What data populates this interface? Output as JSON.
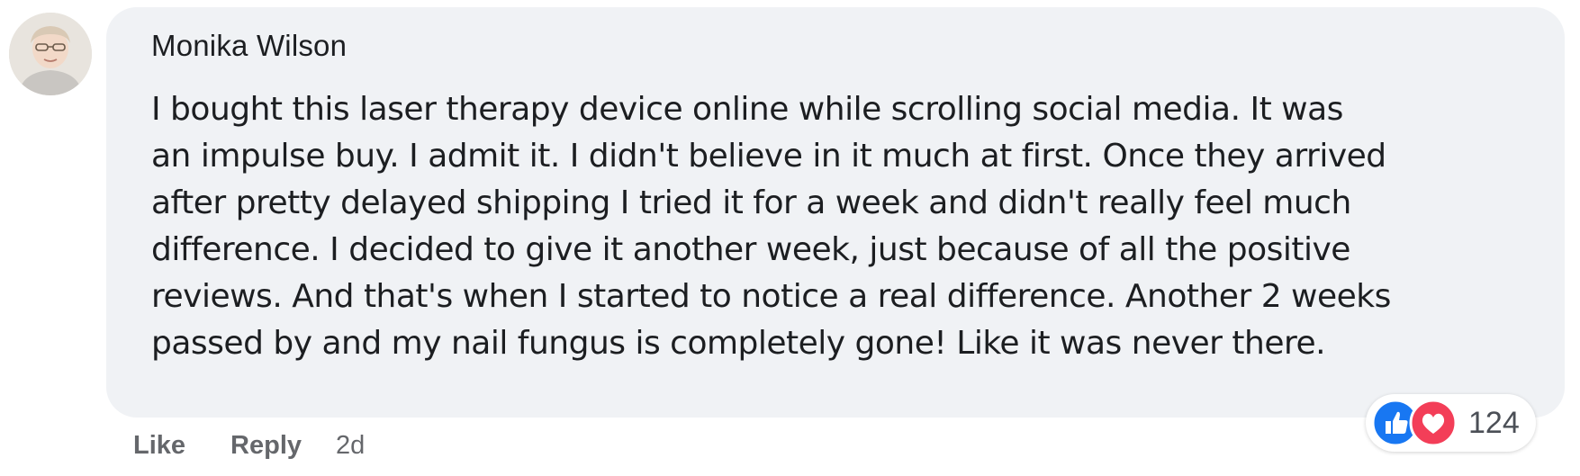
{
  "comment": {
    "author": "Monika Wilson",
    "text_lines": [
      "I bought this laser therapy device online while scrolling social media. It was",
      "an impulse buy. I admit it. I didn't believe in it much at first. Once they arrived",
      "after pretty delayed shipping I tried it for a week and didn't really feel much",
      "difference. I decided to give it another week, just because of all the positive",
      "reviews. And that's when I started to notice a real difference. Another 2 weeks",
      "passed by and my nail fungus is completely gone! Like it was never there."
    ],
    "bubble_color": "#f0f2f5"
  },
  "actions": {
    "like_label": "Like",
    "reply_label": "Reply",
    "timestamp": "2d"
  },
  "reactions": {
    "icons": [
      "like-icon",
      "love-icon"
    ],
    "count": "124",
    "like_color": "#1877f2",
    "love_color": "#f33e58"
  }
}
